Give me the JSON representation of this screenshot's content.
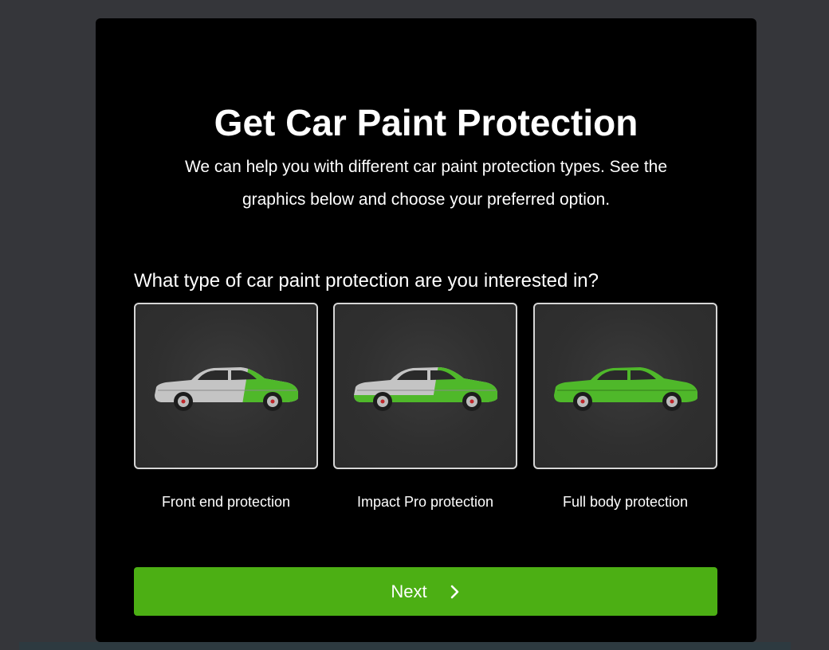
{
  "title": "Get Car Paint Protection",
  "subtitle": "We can help you with different car paint protection types. See the graphics below and choose your preferred option.",
  "question": "What type of car paint protection are you interested in?",
  "options": [
    {
      "label": "Front end protection",
      "icon": "car-front-end-icon"
    },
    {
      "label": "Impact Pro protection",
      "icon": "car-impact-pro-icon"
    },
    {
      "label": "Full body protection",
      "icon": "car-full-body-icon"
    }
  ],
  "next_button": {
    "label": "Next",
    "icon": "chevron-right-icon"
  },
  "colors": {
    "accent": "#4caf14",
    "card": "#000000",
    "background": "#35363a",
    "protection": "#4fb82a",
    "car_body": "#bdbdbd"
  }
}
